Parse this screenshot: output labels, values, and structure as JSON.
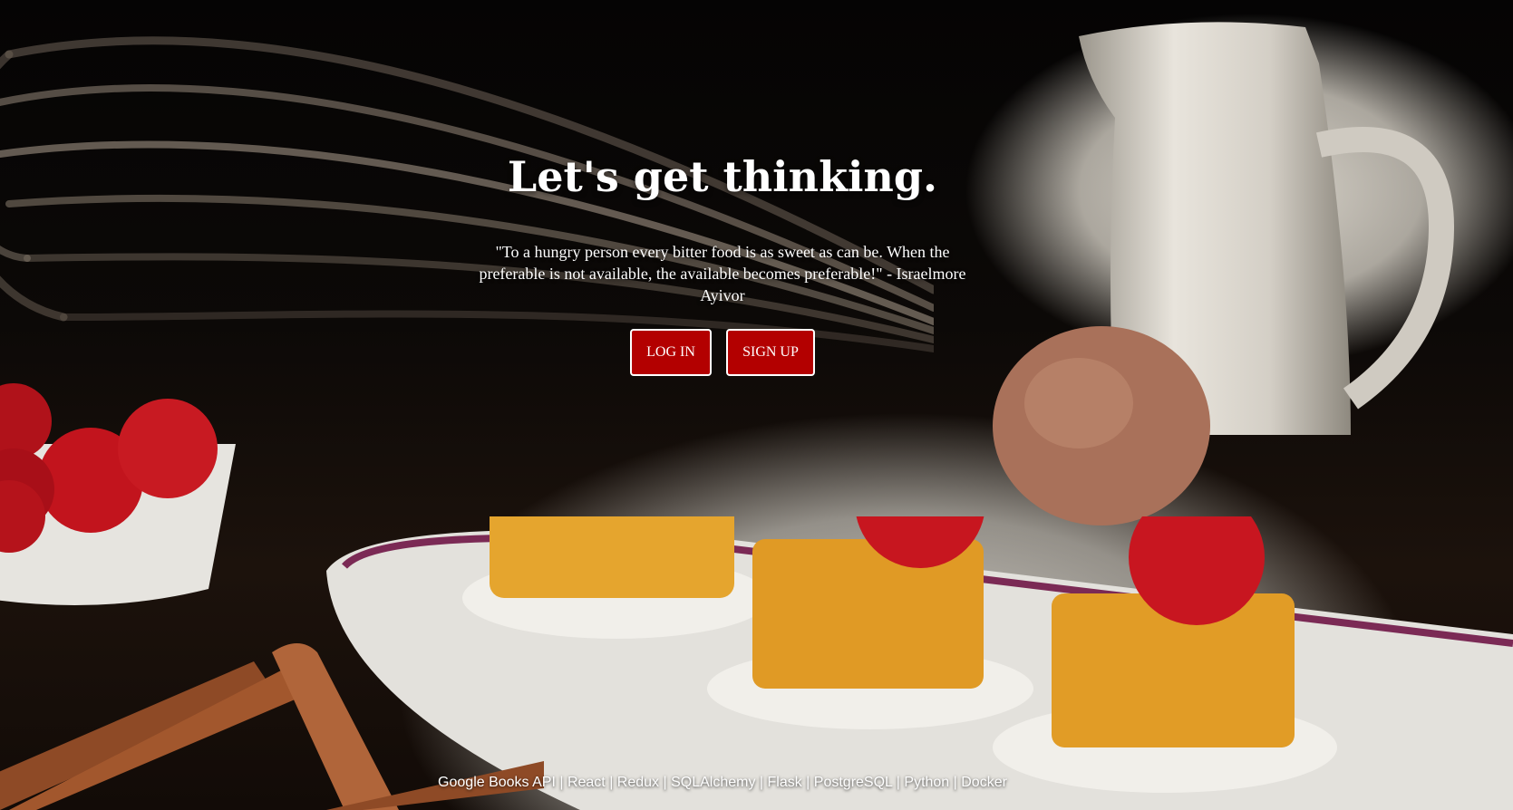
{
  "hero": {
    "title": "Let's get thinking.",
    "quote": "\"To a hungry person every bitter food is as sweet as can be. When the preferable is not available, the available becomes preferable!\" - Israelmore Ayivor"
  },
  "actions": {
    "login_label": "LOG IN",
    "signup_label": "SIGN UP"
  },
  "footer": {
    "tech_stack": "Google Books API | React | Redux | SQLAlchemy | Flask | PostgreSQL | Python | Docker"
  },
  "colors": {
    "button_bg": "#b30000",
    "button_border": "#ffffff",
    "text": "#ffffff"
  }
}
